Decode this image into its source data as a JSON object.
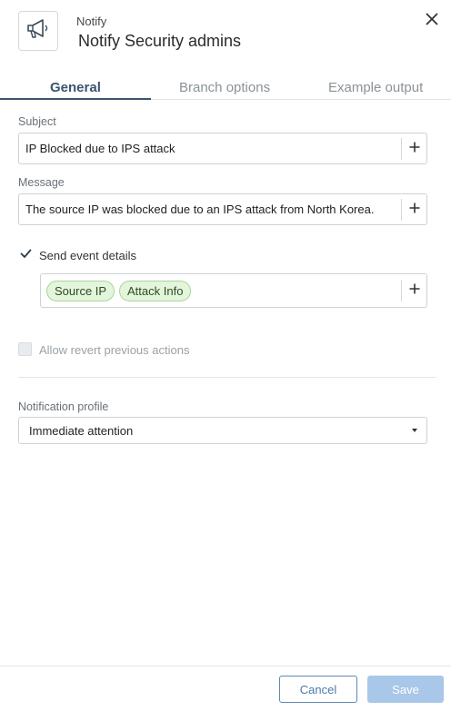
{
  "header": {
    "overline": "Notify",
    "title": "Notify Security admins",
    "icon": "megaphone-icon",
    "close_icon": "close-icon"
  },
  "tabs": [
    {
      "label": "General",
      "active": true
    },
    {
      "label": "Branch options",
      "active": false
    },
    {
      "label": "Example output",
      "active": false
    }
  ],
  "subject": {
    "label": "Subject",
    "value": "IP Blocked due to IPS attack"
  },
  "message": {
    "label": "Message",
    "value": "The source IP was blocked due to an IPS attack from North Korea."
  },
  "send_event_details": {
    "label": "Send event details",
    "checked": true,
    "chips": [
      "Source IP",
      "Attack Info"
    ]
  },
  "allow_revert": {
    "label": "Allow revert previous actions",
    "checked": false,
    "disabled": true
  },
  "notification_profile": {
    "label": "Notification profile",
    "selected": "Immediate attention"
  },
  "footer": {
    "cancel_label": "Cancel",
    "save_label": "Save"
  },
  "colors": {
    "accent": "#3a5470",
    "chip_bg": "#e3f5db",
    "chip_border": "#a9d69a",
    "save_disabled": "#a9c7e8",
    "cancel_border": "#5e88b3"
  }
}
